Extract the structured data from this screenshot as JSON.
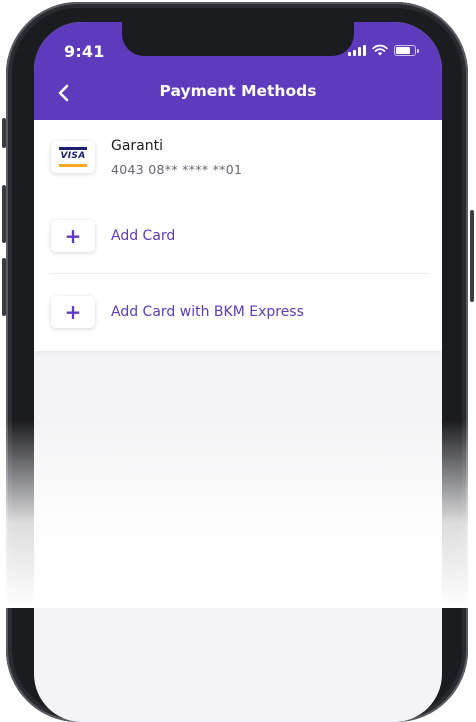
{
  "status_bar": {
    "time": "9:41",
    "signal_icon": "cellular-signal-icon",
    "wifi_icon": "wifi-icon",
    "battery_icon": "battery-icon"
  },
  "colors": {
    "accent": "#5e3bbd",
    "card_text": "#1d1d22",
    "muted_text": "#666873"
  },
  "header": {
    "title": "Payment Methods",
    "back_icon": "chevron-left-icon"
  },
  "cards": [
    {
      "brand": "VISA",
      "name": "Garanti",
      "number": "4043 08** **** **01"
    }
  ],
  "actions": [
    {
      "label": "Add Card",
      "icon": "plus-icon"
    },
    {
      "label": "Add Card with BKM Express",
      "icon": "plus-icon"
    }
  ]
}
